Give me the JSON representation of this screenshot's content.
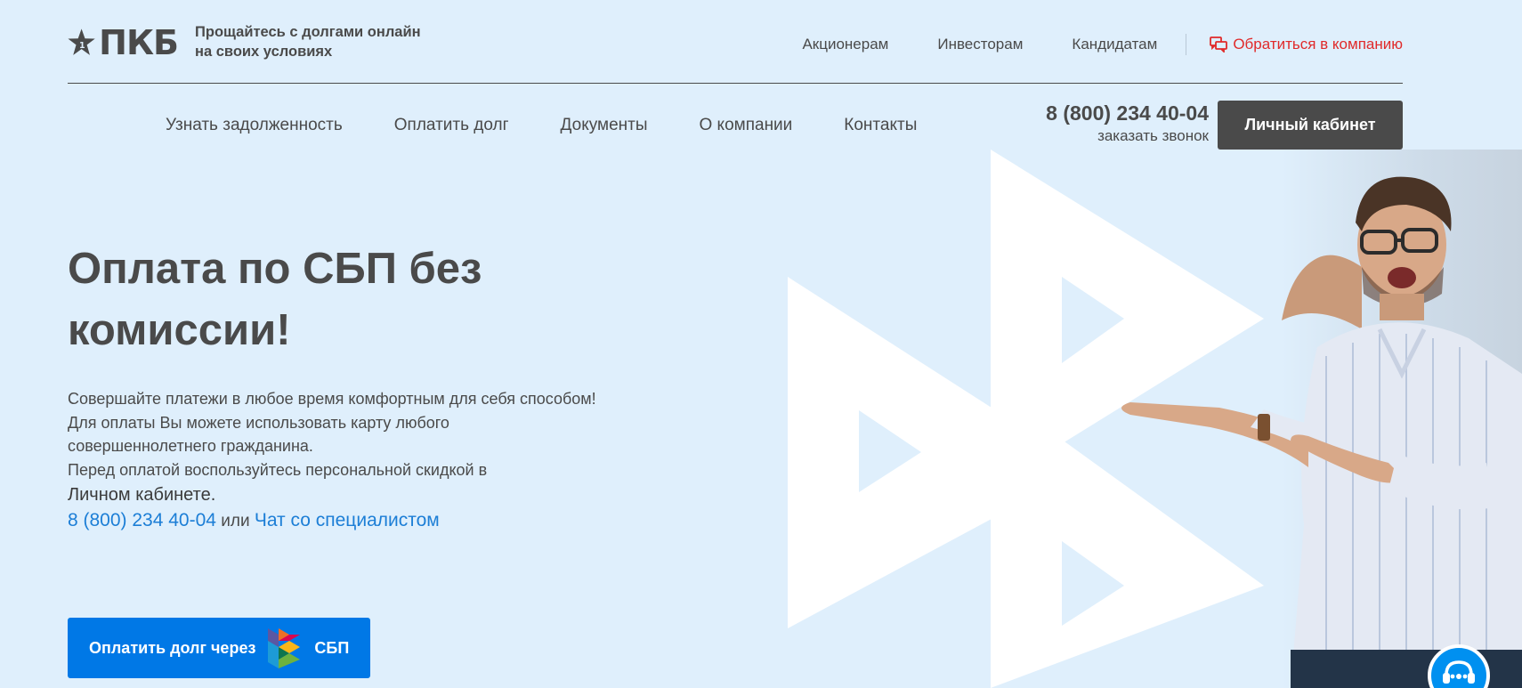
{
  "header": {
    "logo_text": "ПКБ",
    "tagline_line1": "Прощайтесь с долгами онлайн",
    "tagline_line2": "на своих условиях",
    "top_links": [
      "Акционерам",
      "Инвесторам",
      "Кандидатам"
    ],
    "contact_company": "Обратиться в компанию"
  },
  "nav": {
    "items": [
      "Узнать задолженность",
      "Оплатить долг",
      "Документы",
      "О компании",
      "Контакты"
    ],
    "phone": "8 (800) 234 40-04",
    "callback": "заказать звонок",
    "cabinet_button": "Личный кабинет"
  },
  "hero": {
    "title_line1": "Оплата по СБП без",
    "title_line2": "комиссии!",
    "text_line1": "Совершайте платежи в любое время комфортным для себя способом!",
    "text_line2": "Для оплаты Вы можете использовать карту любого",
    "text_line3": "совершеннолетнего гражданина.",
    "text_line4": "Перед оплатой воспользуйтесь персональной скидкой в",
    "text_cabinet_link": "Личном кабинете",
    "text_period": ".",
    "contact_phone": "8 (800) 234 40-04",
    "contact_or": " или ",
    "contact_chat": "Чат со специалистом",
    "pay_button_label": "Оплатить долг через",
    "pay_button_sbp": "СБП"
  },
  "colors": {
    "background": "#dfeffc",
    "text": "#4a4a4a",
    "accent_red": "#e02a2a",
    "link_blue": "#1c7ed6",
    "button_blue": "#0078e6",
    "button_dark": "#4a4a4a"
  },
  "icons": [
    "star-logo-icon",
    "chat-bubbles-icon",
    "sbp-logo-icon",
    "chat-support-icon"
  ]
}
